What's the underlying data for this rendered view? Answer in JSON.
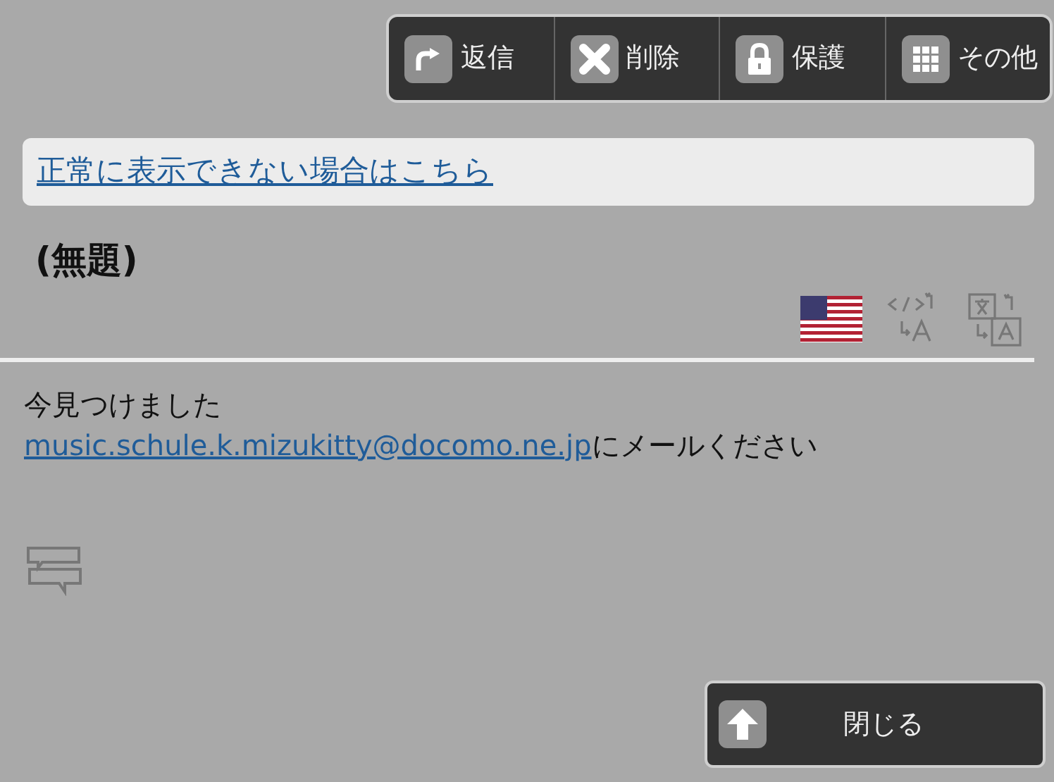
{
  "toolbar": [
    {
      "kind": "reply",
      "label": "返信"
    },
    {
      "kind": "delete",
      "label": "削除"
    },
    {
      "kind": "protect",
      "label": "保護"
    },
    {
      "kind": "more",
      "label": "その他"
    }
  ],
  "notice_link": "正常に表示できない場合はこちら",
  "subject": "(無題)",
  "body": {
    "line_1": "今見つけました",
    "email_link": "music.schule.k.mizukitty@docomo.ne.jp",
    "line_2_rest": "にメールください"
  },
  "close_button": "閉じる"
}
